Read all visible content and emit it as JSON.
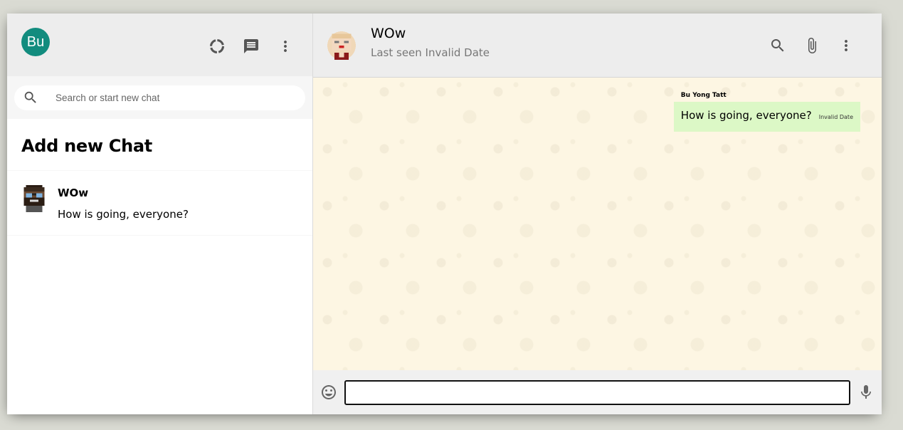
{
  "sidebar": {
    "user_avatar_text": "Bu",
    "search_placeholder": "Search or start new chat",
    "add_chat_label": "Add new Chat",
    "chats": [
      {
        "name": "WOw",
        "last_message": "How is going, everyone?"
      }
    ]
  },
  "chat": {
    "contact_name": "WOw",
    "last_seen": "Last seen Invalid Date",
    "messages": [
      {
        "sender": "Bu Yong Tatt",
        "text": "How is going, everyone?",
        "time": "Invalid Date"
      }
    ],
    "input_value": ""
  },
  "colors": {
    "accent": "#128c7e",
    "bubble": "#dcf8c6",
    "header_bg": "#ededed",
    "chat_bg": "#fdf6e3"
  },
  "icons": {
    "status": "status-icon",
    "new_chat": "chat-icon",
    "menu": "more-vert-icon",
    "search": "search-icon",
    "attach": "attach-icon",
    "emoji": "emoji-icon",
    "mic": "mic-icon"
  }
}
